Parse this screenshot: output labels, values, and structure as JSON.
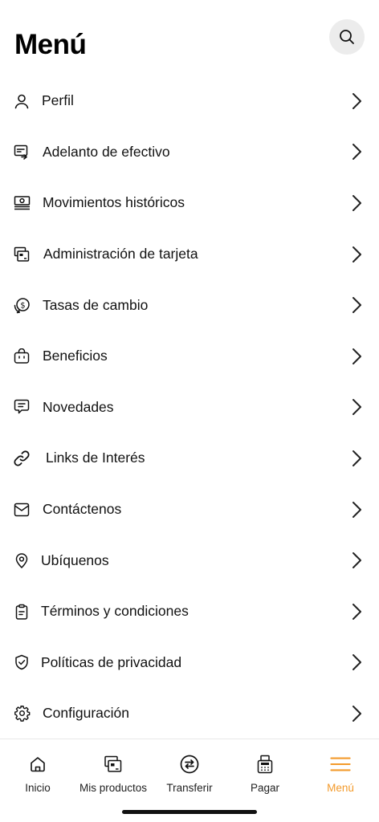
{
  "header": {
    "title": "Menú",
    "search_icon": "search-icon"
  },
  "menu": [
    {
      "label": "Perfil",
      "icon": "user-icon"
    },
    {
      "label": "Adelanto de efectivo",
      "icon": "cash-advance-icon"
    },
    {
      "label": "Movimientos históricos",
      "icon": "money-history-icon"
    },
    {
      "label": "Administración de tarjeta",
      "icon": "card-admin-icon"
    },
    {
      "label": "Tasas de cambio",
      "icon": "exchange-rate-icon"
    },
    {
      "label": "Beneficios",
      "icon": "benefits-bag-icon"
    },
    {
      "label": "Novedades",
      "icon": "news-chat-icon"
    },
    {
      "label": "Links de Interés",
      "icon": "link-icon"
    },
    {
      "label": "Contáctenos",
      "icon": "mail-icon"
    },
    {
      "label": "Ubíquenos",
      "icon": "location-pin-icon"
    },
    {
      "label": "Términos y condiciones",
      "icon": "clipboard-icon"
    },
    {
      "label": "Políticas de privacidad",
      "icon": "shield-check-icon"
    },
    {
      "label": "Configuración",
      "icon": "gear-icon"
    }
  ],
  "bottom_nav": [
    {
      "label": "Inicio",
      "icon": "home-icon",
      "active": false
    },
    {
      "label": "Mis productos",
      "icon": "cards-icon",
      "active": false
    },
    {
      "label": "Transferir",
      "icon": "transfer-icon",
      "active": false
    },
    {
      "label": "Pagar",
      "icon": "pay-icon",
      "active": false
    },
    {
      "label": "Menú",
      "icon": "menu-icon",
      "active": true
    }
  ],
  "colors": {
    "accent": "#f39a2b",
    "text": "#111111",
    "search_bg": "#ececec"
  }
}
